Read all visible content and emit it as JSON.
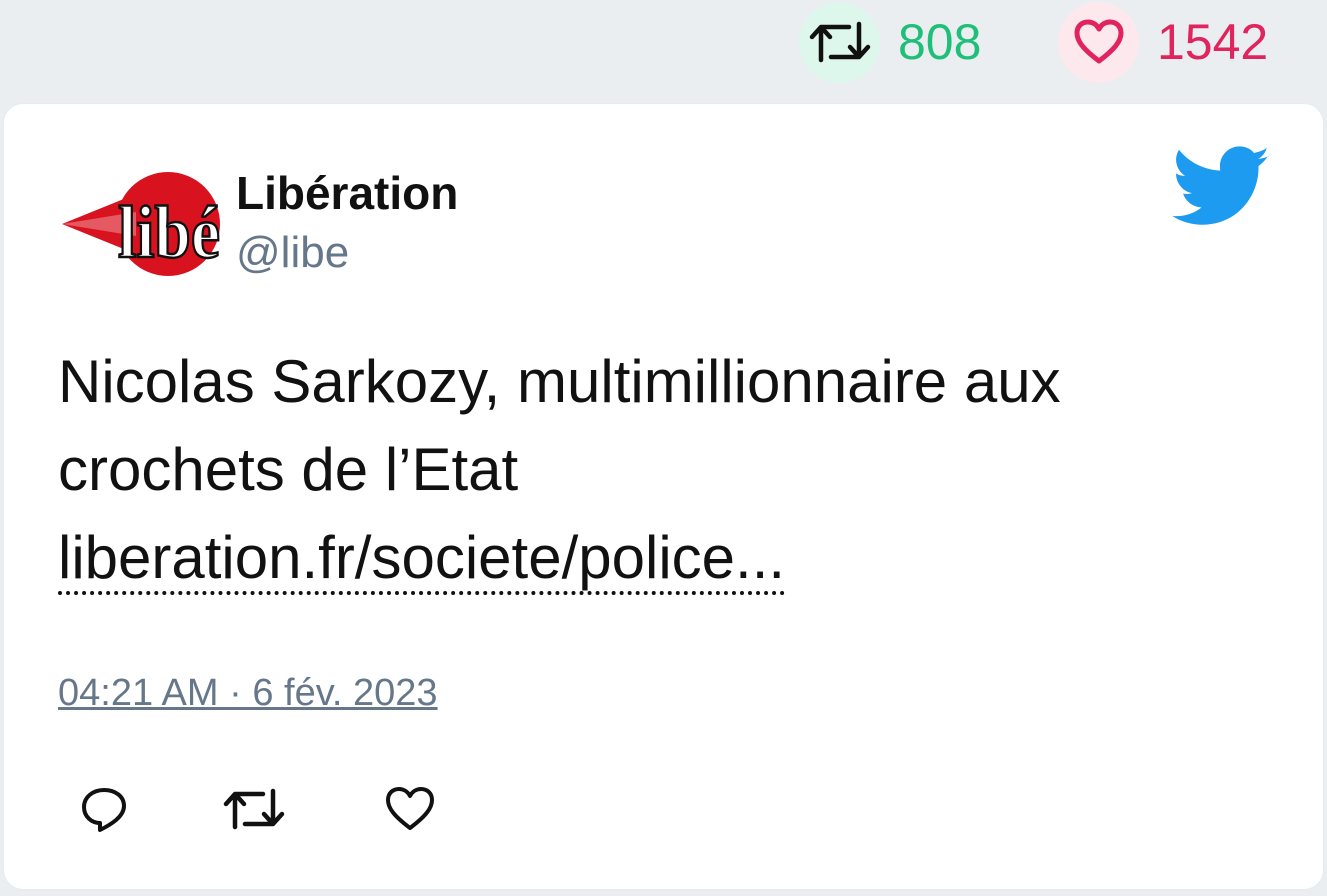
{
  "stats": {
    "retweet_count": "808",
    "like_count": "1542",
    "retweet_color": "#1fbf79",
    "like_color": "#e0245e"
  },
  "author": {
    "avatar_text": "libé",
    "name": "Libération",
    "handle": "@libe"
  },
  "tweet": {
    "text_line1": "Nicolas Sarkozy, multimillionnaire aux",
    "text_line2": "crochets de l’Etat",
    "link": "liberation.fr/societe/police...",
    "timestamp": "04:21 AM · 6 fév. 2023"
  },
  "icons": {
    "header_retweet": "retweet-icon",
    "header_like": "heart-icon",
    "brand": "twitter-bird-icon",
    "reply": "reply-icon",
    "retweet": "retweet-icon",
    "like": "heart-icon"
  },
  "colors": {
    "brand_blue": "#1d9bf0",
    "muted_text": "#66778a",
    "libe_red": "#d8121f"
  }
}
